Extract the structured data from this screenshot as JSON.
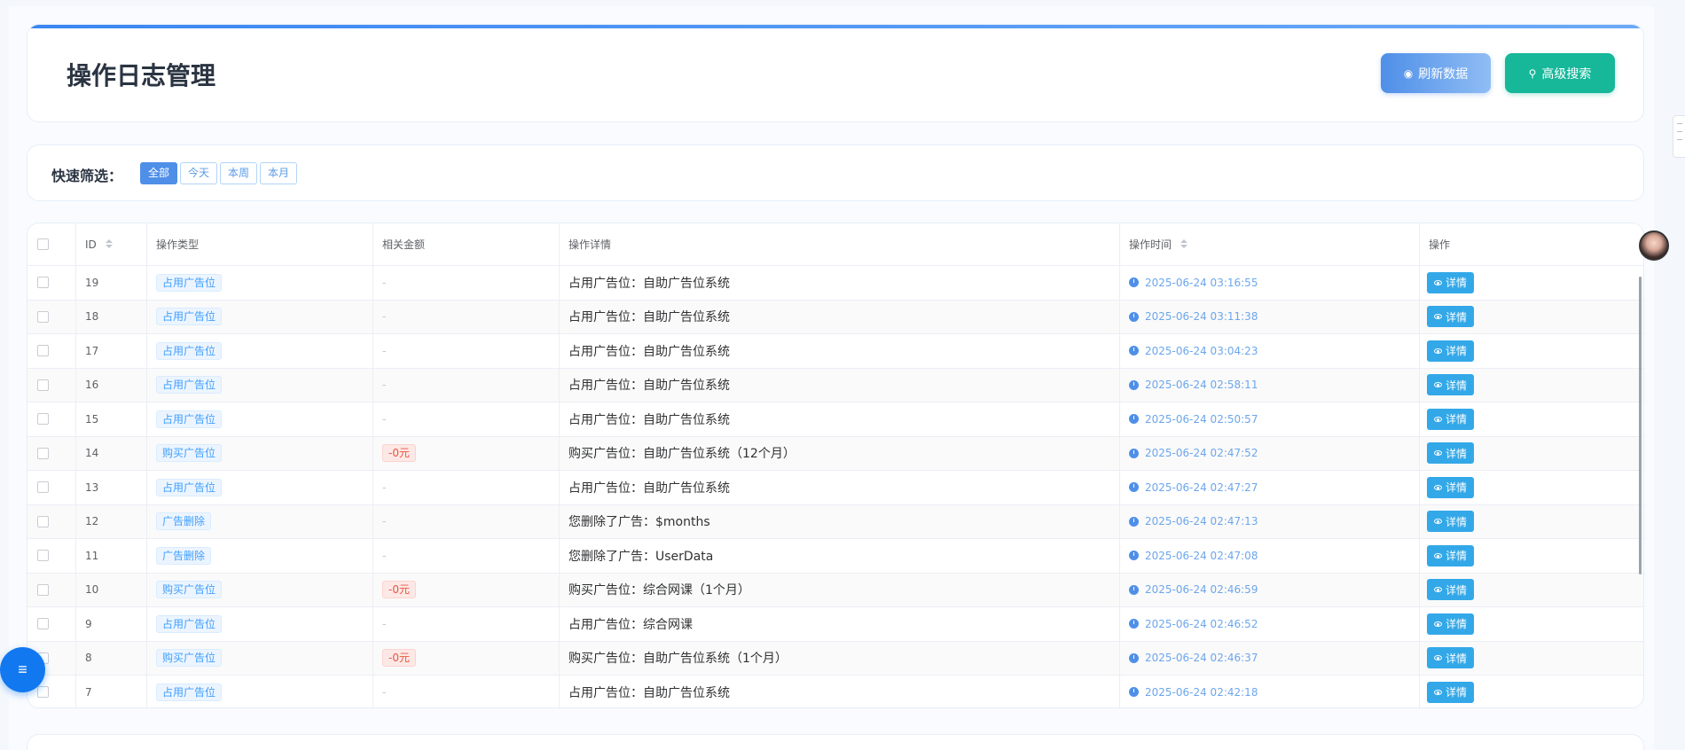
{
  "page": {
    "title": "操作日志管理"
  },
  "header": {
    "refresh_label": "刷新数据",
    "search_label": "高级搜索"
  },
  "filter": {
    "label": "快速筛选：",
    "tabs": [
      "全部",
      "今天",
      "本周",
      "本月"
    ],
    "active_tab": "全部"
  },
  "table": {
    "columns": [
      "ID",
      "操作类型",
      "相关金额",
      "操作详情",
      "操作时间",
      "操作"
    ],
    "detail_button_label": "详情",
    "rows": [
      {
        "id": "19",
        "type": "占用广告位",
        "amount": "-",
        "detail": "占用广告位：自助广告位系统",
        "time": "2025-06-24 03:16:55"
      },
      {
        "id": "18",
        "type": "占用广告位",
        "amount": "-",
        "detail": "占用广告位：自助广告位系统",
        "time": "2025-06-24 03:11:38"
      },
      {
        "id": "17",
        "type": "占用广告位",
        "amount": "-",
        "detail": "占用广告位：自助广告位系统",
        "time": "2025-06-24 03:04:23"
      },
      {
        "id": "16",
        "type": "占用广告位",
        "amount": "-",
        "detail": "占用广告位：自助广告位系统",
        "time": "2025-06-24 02:58:11"
      },
      {
        "id": "15",
        "type": "占用广告位",
        "amount": "-",
        "detail": "占用广告位：自助广告位系统",
        "time": "2025-06-24 02:50:57"
      },
      {
        "id": "14",
        "type": "购买广告位",
        "amount": "-0元",
        "detail": "购买广告位：自助广告位系统（12个月）",
        "time": "2025-06-24 02:47:52"
      },
      {
        "id": "13",
        "type": "占用广告位",
        "amount": "-",
        "detail": "占用广告位：自助广告位系统",
        "time": "2025-06-24 02:47:27"
      },
      {
        "id": "12",
        "type": "广告删除",
        "amount": "-",
        "detail": "您删除了广告：$months",
        "time": "2025-06-24 02:47:13"
      },
      {
        "id": "11",
        "type": "广告删除",
        "amount": "-",
        "detail": "您删除了广告：UserData",
        "time": "2025-06-24 02:47:08"
      },
      {
        "id": "10",
        "type": "购买广告位",
        "amount": "-0元",
        "detail": "购买广告位：综合网课（1个月）",
        "time": "2025-06-24 02:46:59"
      },
      {
        "id": "9",
        "type": "占用广告位",
        "amount": "-",
        "detail": "占用广告位：综合网课",
        "time": "2025-06-24 02:46:52"
      },
      {
        "id": "8",
        "type": "购买广告位",
        "amount": "-0元",
        "detail": "购买广告位：自助广告位系统（1个月）",
        "time": "2025-06-24 02:46:37"
      },
      {
        "id": "7",
        "type": "占用广告位",
        "amount": "-",
        "detail": "占用广告位：自助广告位系统",
        "time": "2025-06-24 02:42:18"
      }
    ]
  },
  "fab": {
    "icon": "≡"
  },
  "icons": {
    "refresh": "refresh-icon",
    "search": "search-icon",
    "clock": "clock-icon",
    "eye": "eye-icon",
    "menu": "menu-icon"
  },
  "colors": {
    "primary": "#4f8fe8",
    "teal": "#17b79a",
    "danger": "#e8563f",
    "fab": "#1278f0"
  }
}
